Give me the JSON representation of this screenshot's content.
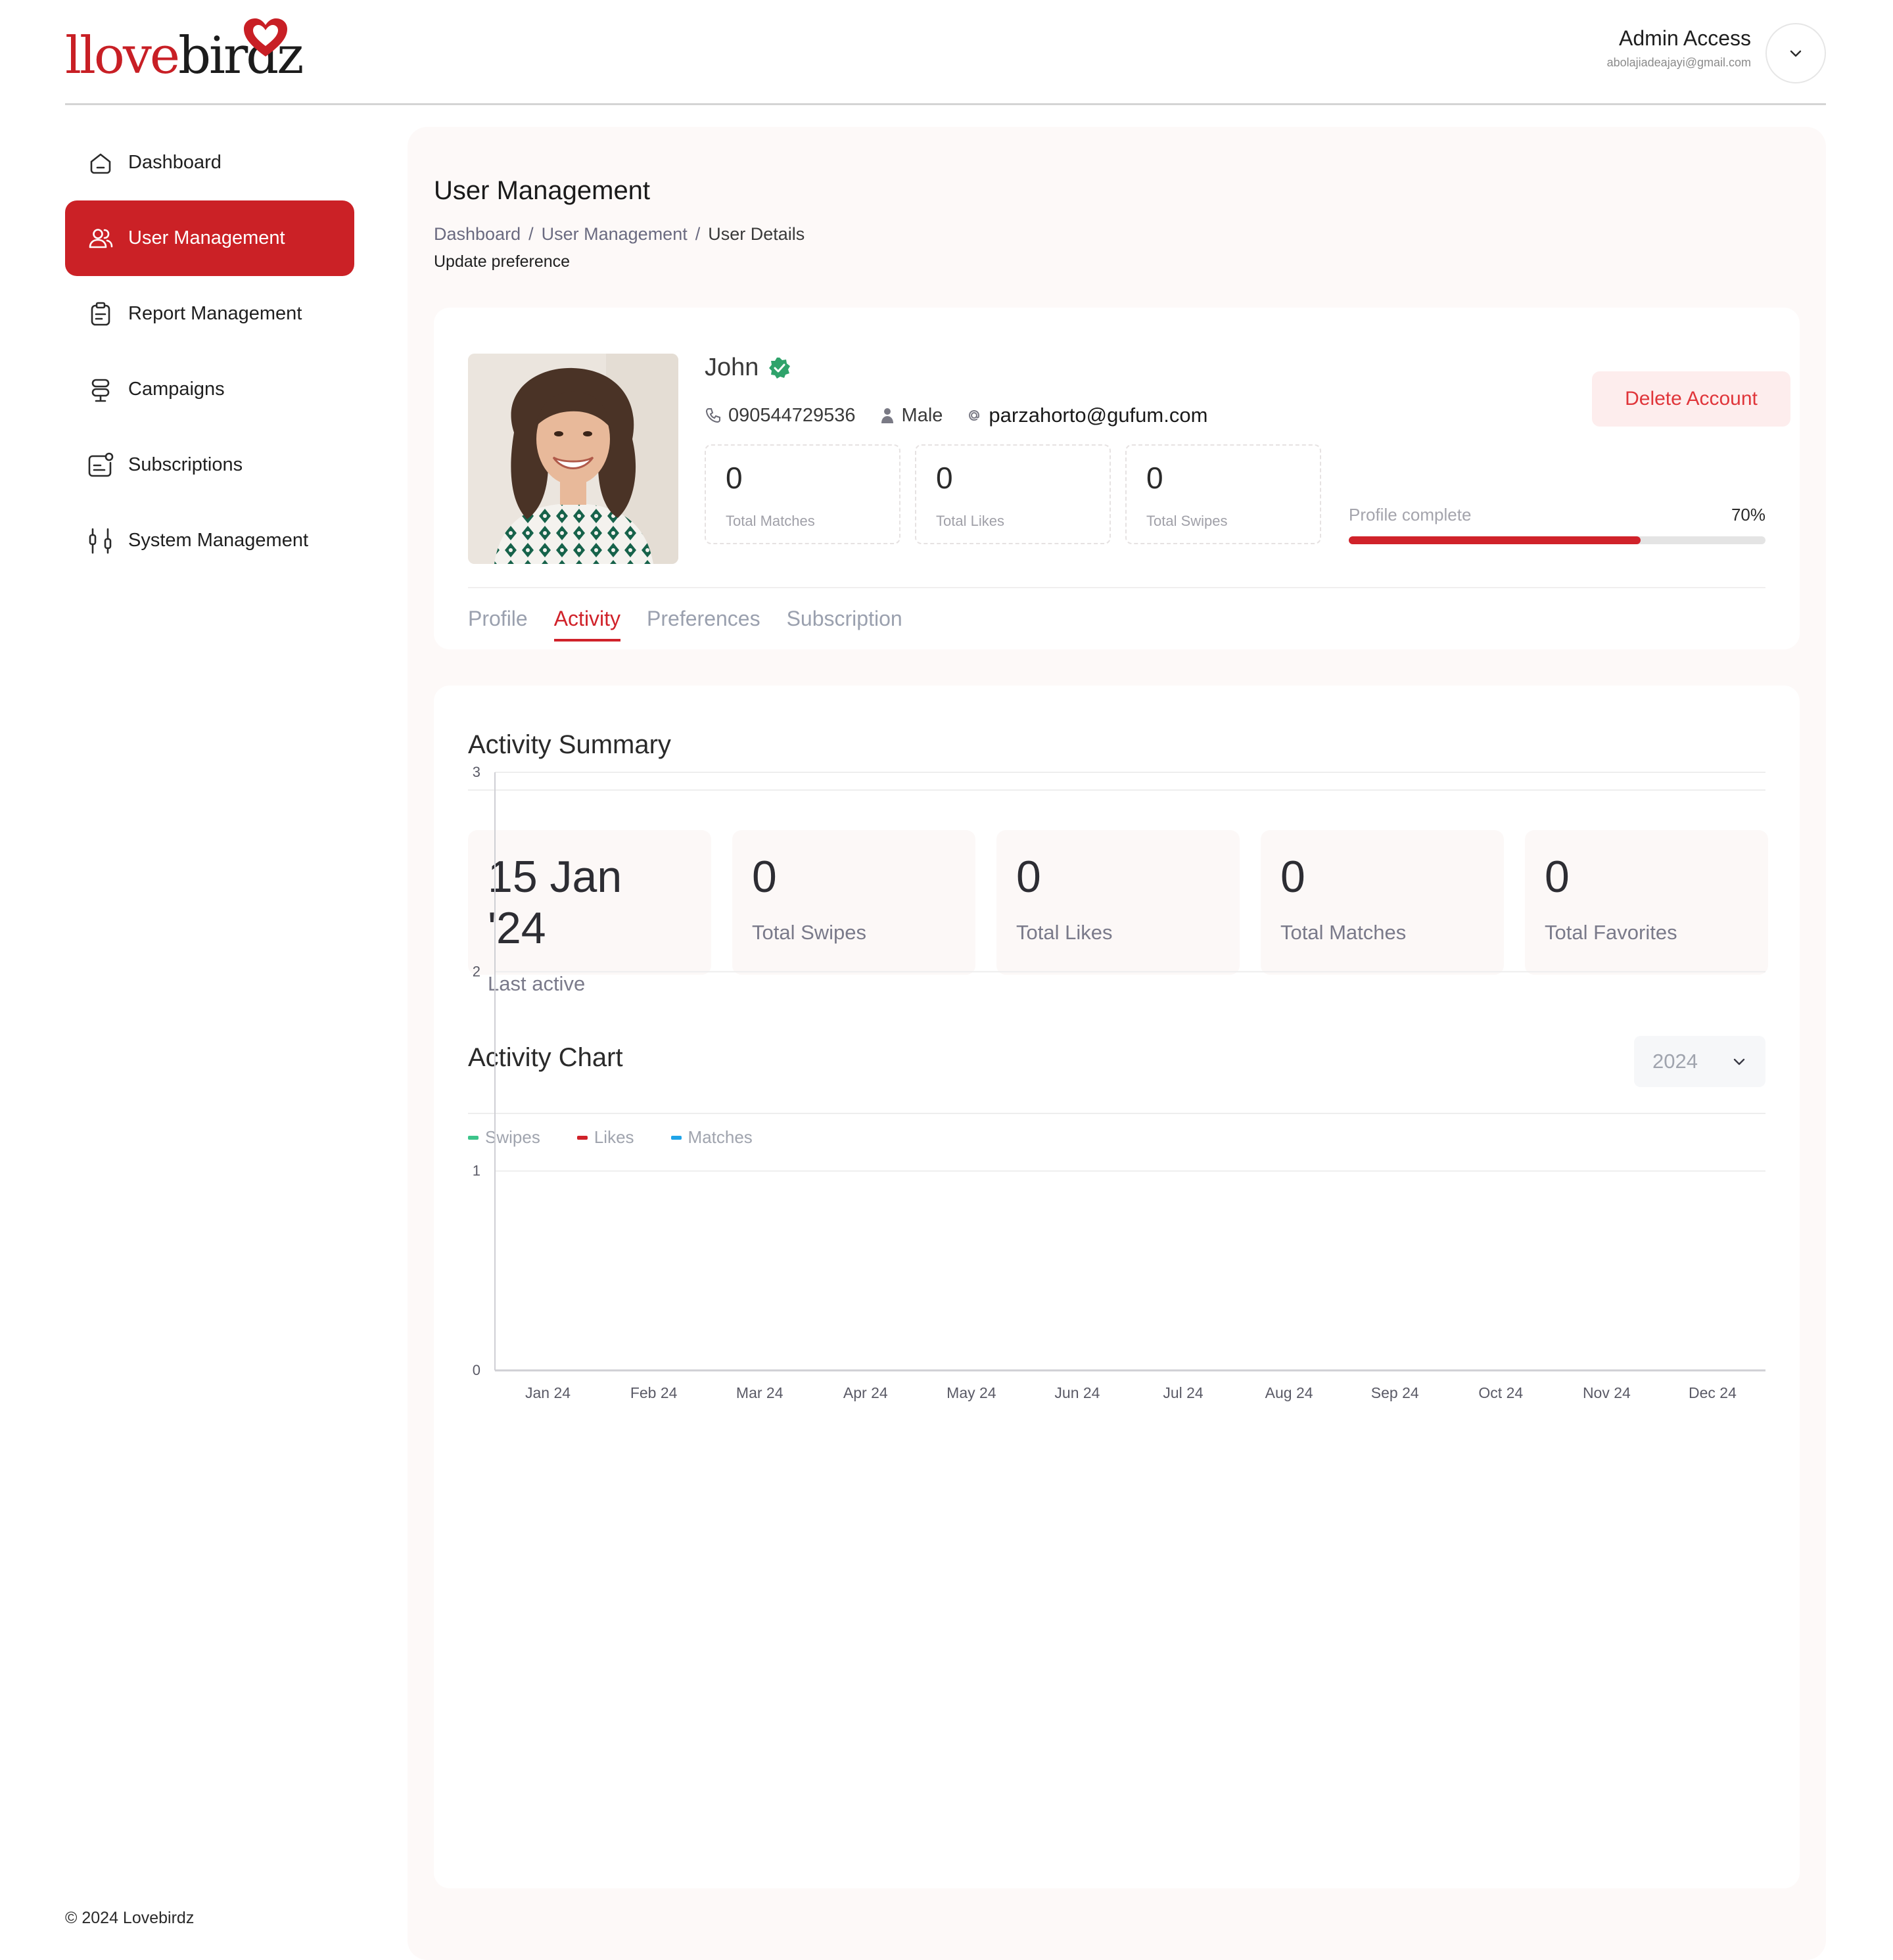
{
  "header": {
    "logo_text_dark_1": "love",
    "logo_text_dark_2": "birdz",
    "admin_name": "Admin Access",
    "admin_email": "abolajiadeajayi@gmail.com"
  },
  "sidebar": {
    "items": [
      {
        "label": "Dashboard",
        "icon": "home-icon"
      },
      {
        "label": "User Management",
        "icon": "users-icon",
        "active": true
      },
      {
        "label": "Report Management",
        "icon": "clipboard-icon"
      },
      {
        "label": "Campaigns",
        "icon": "signpost-icon"
      },
      {
        "label": "Subscriptions",
        "icon": "subscription-icon"
      },
      {
        "label": "System Management",
        "icon": "sliders-icon"
      }
    ],
    "footer": "© 2024 Lovebirdz"
  },
  "page": {
    "title": "User Management",
    "breadcrumb": [
      "Dashboard",
      "User Management",
      "User Details"
    ],
    "breadcrumb_sep": "/",
    "subtitle": "Update preference"
  },
  "profile": {
    "name": "John",
    "phone": "090544729536",
    "gender": "Male",
    "email": "parzahorto@gufum.com",
    "stats": [
      {
        "value": "0",
        "label": "Total Matches"
      },
      {
        "value": "0",
        "label": "Total Likes"
      },
      {
        "value": "0",
        "label": "Total Swipes"
      }
    ],
    "delete_label": "Delete Account",
    "progress_label": "Profile complete",
    "progress_text": "70%",
    "progress_value": 0.7
  },
  "tabs": [
    "Profile",
    "Activity",
    "Preferences",
    "Subscription"
  ],
  "active_tab": "Activity",
  "activity": {
    "summary_title": "Activity Summary",
    "tiles": [
      {
        "value": "15 Jan '24",
        "label": "Last active"
      },
      {
        "value": "0",
        "label": "Total Swipes"
      },
      {
        "value": "0",
        "label": "Total Likes"
      },
      {
        "value": "0",
        "label": "Total Matches"
      },
      {
        "value": "0",
        "label": "Total Favorites"
      }
    ],
    "chart_title": "Activity Chart",
    "year": "2024"
  },
  "colors": {
    "brand_red": "#cb2126",
    "swipes": "#3cc48a",
    "likes": "#d0222a",
    "matches": "#1fa4e8",
    "verified": "#2fa36b"
  },
  "chart_data": {
    "type": "line",
    "categories": [
      "Jan 24",
      "Feb 24",
      "Mar 24",
      "Apr 24",
      "May 24",
      "Jun 24",
      "Jul 24",
      "Aug 24",
      "Sep 24",
      "Oct 24",
      "Nov 24",
      "Dec 24"
    ],
    "series": [
      {
        "name": "Swipes",
        "values": [
          0,
          0,
          0,
          0,
          0,
          0,
          0,
          0,
          0,
          0,
          0,
          0
        ]
      },
      {
        "name": "Likes",
        "values": [
          0,
          0,
          0,
          0,
          0,
          0,
          0,
          0,
          0,
          0,
          0,
          0
        ]
      },
      {
        "name": "Matches",
        "values": [
          0,
          0,
          0,
          0,
          0,
          0,
          0,
          0,
          0,
          0,
          0,
          0
        ]
      }
    ],
    "yticks": [
      "0",
      "1",
      "2",
      "3"
    ],
    "ylim": [
      0,
      3
    ],
    "grid": true,
    "legend": "top-left"
  }
}
